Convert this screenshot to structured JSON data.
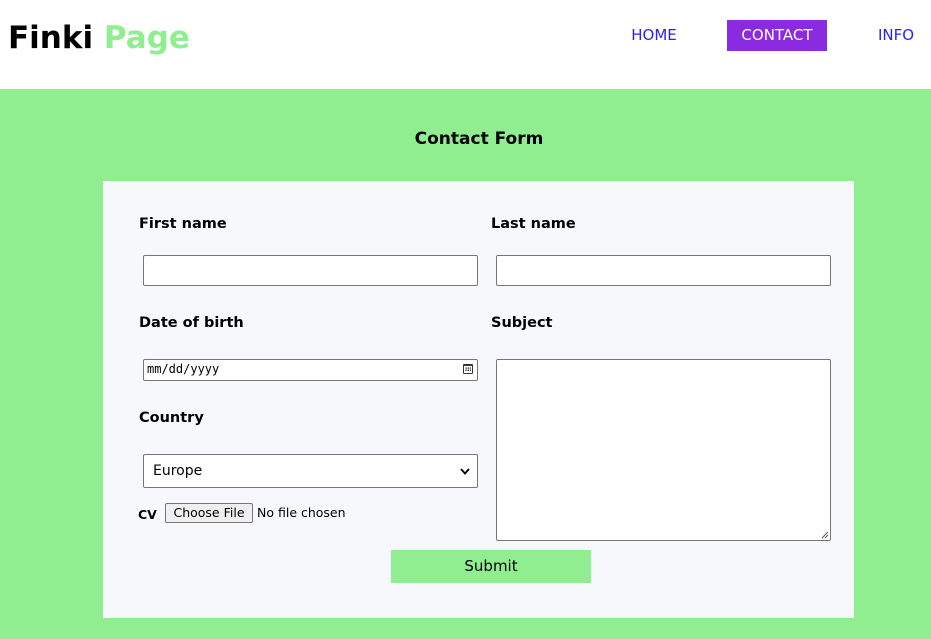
{
  "header": {
    "logo_part1": "Finki",
    "logo_part2": "Page",
    "nav": {
      "home": "HOME",
      "contact": "CONTACT",
      "info": "INFO"
    },
    "active_nav": "CONTACT"
  },
  "form": {
    "title": "Contact Form",
    "first_name_label": "First name",
    "first_name_value": "",
    "last_name_label": "Last name",
    "last_name_value": "",
    "dob_label": "Date of birth",
    "dob_placeholder": "mm/dd/yyyy",
    "subject_label": "Subject",
    "subject_value": "",
    "country_label": "Country",
    "country_selected": "Europe",
    "cv_label": "CV",
    "file_button": "Choose File",
    "file_status": "No file chosen",
    "submit_label": "Submit"
  },
  "colors": {
    "page_bg": "#90ee90",
    "accent_green": "#90ee90",
    "active_nav_bg": "#8a2be2",
    "nav_link": "#2a1ff0",
    "card_bg": "#f7f8fc"
  },
  "icons": [
    "calendar-icon",
    "chevron-down-icon",
    "resize-grip-icon"
  ]
}
